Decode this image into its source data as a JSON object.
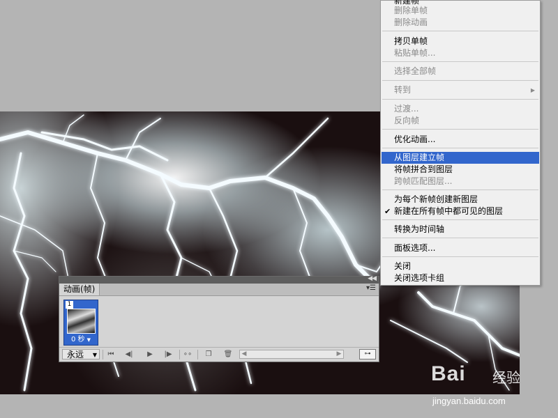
{
  "context_menu": {
    "items": [
      {
        "label": "新建帧",
        "disabled": false
      },
      {
        "label": "删除单帧",
        "disabled": true
      },
      {
        "label": "删除动画",
        "disabled": true
      },
      {
        "label": "拷贝单帧",
        "disabled": false
      },
      {
        "label": "粘贴单帧...",
        "disabled": true
      },
      {
        "label": "选择全部帧",
        "disabled": true
      },
      {
        "label": "转到",
        "disabled": true,
        "submenu": true
      },
      {
        "label": "过渡...",
        "disabled": true
      },
      {
        "label": "反向帧",
        "disabled": true
      },
      {
        "label": "优化动画...",
        "disabled": false
      },
      {
        "label": "从图层建立帧",
        "disabled": false,
        "highlighted": true
      },
      {
        "label": "将帧拼合到图层",
        "disabled": false
      },
      {
        "label": "跨帧匹配图层...",
        "disabled": true
      },
      {
        "label": "为每个新帧创建新图层",
        "disabled": false
      },
      {
        "label": "新建在所有帧中都可见的图层",
        "disabled": false,
        "checked": true
      },
      {
        "label": "转换为时间轴",
        "disabled": false
      },
      {
        "label": "面板选项...",
        "disabled": false
      },
      {
        "label": "关闭",
        "disabled": false
      },
      {
        "label": "关闭选项卡组",
        "disabled": false
      }
    ]
  },
  "animation_panel": {
    "tab_label": "动画(帧)",
    "frame": {
      "number": "1",
      "delay": "0 秒"
    },
    "loop_option": "永远"
  },
  "watermark": {
    "logo_text": "Bai",
    "logo_suffix": "经验",
    "url": "jingyan.baidu.com"
  },
  "colors": {
    "highlight": "#3266cc",
    "menu_bg": "#f0f0f0",
    "workspace": "#b4b4b4"
  }
}
